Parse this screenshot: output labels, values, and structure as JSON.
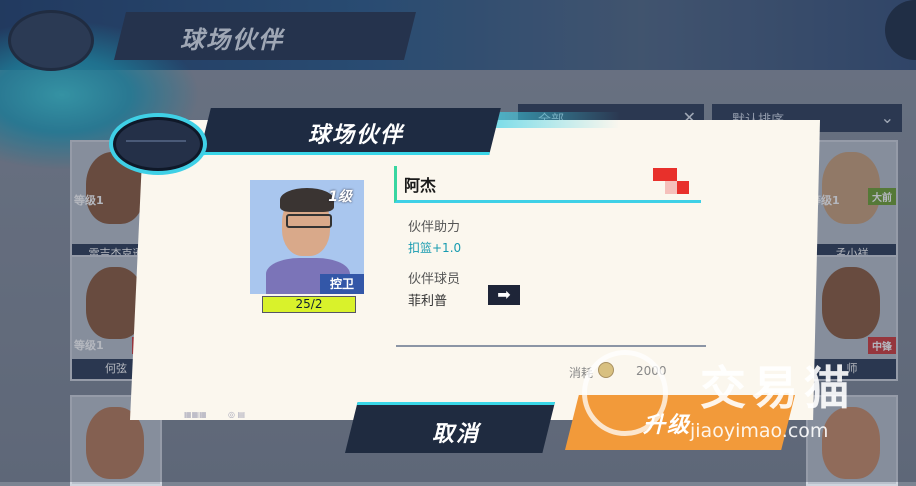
{
  "background": {
    "title": "球场伙伴",
    "filters": [
      {
        "label": "全部"
      },
      {
        "label": "默认排序"
      }
    ],
    "cards": [
      {
        "level": "等级1",
        "name": "雷吉杰克逊",
        "position": ""
      },
      {
        "level": "等级1",
        "name": "孟小祥",
        "position": "大前"
      },
      {
        "level": "等级1",
        "name": "何弦",
        "position": "中锋"
      },
      {
        "level": "",
        "name": "师",
        "position": "中锋"
      }
    ]
  },
  "dialog": {
    "title": "球场伙伴",
    "partner": {
      "level_badge": "1级",
      "role": "控卫",
      "progress_text": "25/2",
      "name": "阿杰"
    },
    "assist_label": "伙伴助力",
    "assist_value": "扣篮+1.0",
    "player_label": "伙伴球员",
    "player_value": "菲利普",
    "cost_label": "消耗",
    "cost_value": "2000",
    "cancel_label": "取消",
    "upgrade_label": "升级"
  },
  "watermark": {
    "brand": "交易猫",
    "url": "jiaoyimao.com"
  },
  "colors": {
    "accent_cyan": "#3fd0e6",
    "upgrade_orange": "#f29a3a",
    "dark_navy": "#1f2b40",
    "progress_yellow": "#d9f22b"
  }
}
